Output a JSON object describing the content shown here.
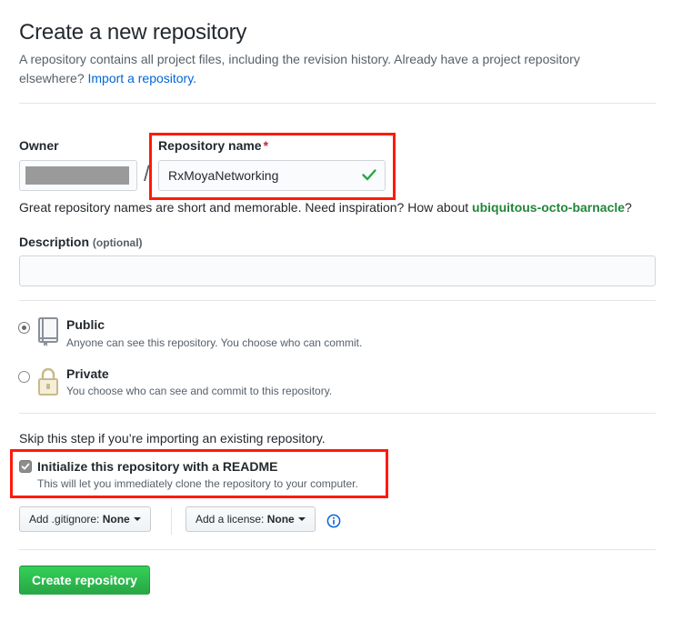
{
  "header": {
    "title": "Create a new repository",
    "subtitle": "A repository contains all project files, including the revision history. Already have a project repository elsewhere?",
    "import_link": "Import a repository."
  },
  "owner": {
    "label": "Owner",
    "separator": "/"
  },
  "repo_name": {
    "label": "Repository name",
    "required_mark": "*",
    "value": "RxMoyaNetworking",
    "hint_prefix": "Great repository names are short and memorable. Need inspiration? How about",
    "suggestion": "ubiquitous-octo-barnacle",
    "hint_suffix": "?"
  },
  "description": {
    "label": "Description",
    "optional": "(optional)",
    "value": ""
  },
  "visibility": {
    "selected": "public",
    "options": [
      {
        "title": "Public",
        "note": "Anyone can see this repository. You choose who can commit.",
        "icon": "repo-book-icon"
      },
      {
        "title": "Private",
        "note": "You choose who can see and commit to this repository.",
        "icon": "lock-icon"
      }
    ]
  },
  "init": {
    "skip_text": "Skip this step if you’re importing an existing repository.",
    "readme_label": "Initialize this repository with a README",
    "readme_note": "This will let you immediately clone the repository to your computer.",
    "readme_checked": true
  },
  "options": {
    "gitignore_prefix": "Add .gitignore:",
    "gitignore_value": "None",
    "license_prefix": "Add a license:",
    "license_value": "None"
  },
  "submit": {
    "label": "Create repository"
  },
  "colors": {
    "highlight_box": "#ff1a0a",
    "primary_button": "#28a745",
    "link": "#0366d6",
    "suggestion": "#22863a"
  }
}
